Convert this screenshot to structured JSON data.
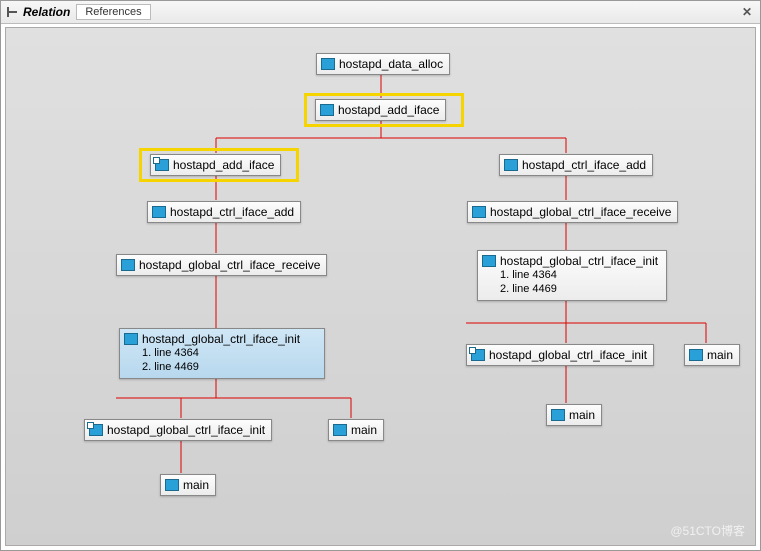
{
  "header": {
    "title": "Relation",
    "tab": "References",
    "close": "✕"
  },
  "watermark": "@51CTO博客",
  "nodes": {
    "root": {
      "label": "hostapd_data_alloc",
      "icon": "ref"
    },
    "add1": {
      "label": "hostapd_add_iface",
      "icon": "ref"
    },
    "add2": {
      "label": "hostapd_add_iface",
      "icon": "def"
    },
    "ctrlAdd_L": {
      "label": "hostapd_ctrl_iface_add",
      "icon": "ref"
    },
    "ctrlAdd_R": {
      "label": "hostapd_ctrl_iface_add",
      "icon": "ref"
    },
    "recv_L": {
      "label": "hostapd_global_ctrl_iface_receive",
      "icon": "ref"
    },
    "recv_R": {
      "label": "hostapd_global_ctrl_iface_receive",
      "icon": "ref"
    },
    "init_L": {
      "label": "hostapd_global_ctrl_iface_init",
      "icon": "ref",
      "lines": [
        "1. line 4364",
        "2. line 4469"
      ]
    },
    "init_R": {
      "label": "hostapd_global_ctrl_iface_init",
      "icon": "ref",
      "lines": [
        "1. line 4364",
        "2. line 4469"
      ]
    },
    "init_L2": {
      "label": "hostapd_global_ctrl_iface_init",
      "icon": "def"
    },
    "init_R2": {
      "label": "hostapd_global_ctrl_iface_init",
      "icon": "def"
    },
    "main_L1": {
      "label": "main",
      "icon": "ref"
    },
    "main_L2": {
      "label": "main",
      "icon": "ref"
    },
    "main_R1": {
      "label": "main",
      "icon": "ref"
    },
    "main_R2": {
      "label": "main",
      "icon": "ref"
    }
  }
}
